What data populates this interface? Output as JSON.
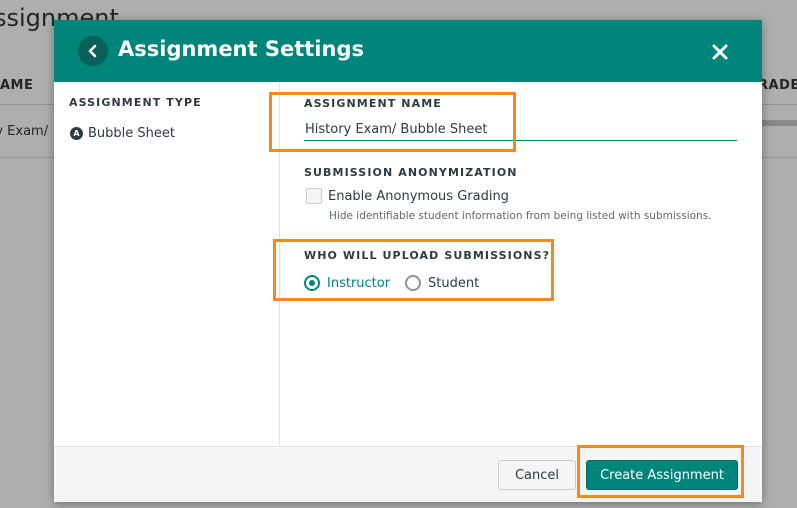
{
  "background": {
    "title": "ssignment",
    "col_left": "AME",
    "col_right": "RADER",
    "row_text": "ry Exam/"
  },
  "modal": {
    "title": "Assignment Settings",
    "back_icon": "chevron-left-icon",
    "close_icon": "close-icon",
    "sidebar": {
      "section_label": "ASSIGNMENT TYPE",
      "type_badge": "A",
      "type_name": "Bubble Sheet"
    },
    "assignment_name": {
      "label": "ASSIGNMENT NAME",
      "value": "History Exam/ Bubble Sheet"
    },
    "anonymization": {
      "label": "SUBMISSION ANONYMIZATION",
      "checkbox_label": "Enable Anonymous Grading",
      "checkbox_checked": false,
      "help_text": "Hide identifiable student information from being listed with submissions."
    },
    "upload": {
      "label": "WHO WILL UPLOAD SUBMISSIONS?",
      "options": [
        {
          "label": "Instructor",
          "selected": true
        },
        {
          "label": "Student",
          "selected": false
        }
      ]
    },
    "footer": {
      "cancel_label": "Cancel",
      "create_label": "Create Assignment"
    }
  },
  "colors": {
    "accent": "#00857a",
    "highlight": "#f28a1e"
  }
}
